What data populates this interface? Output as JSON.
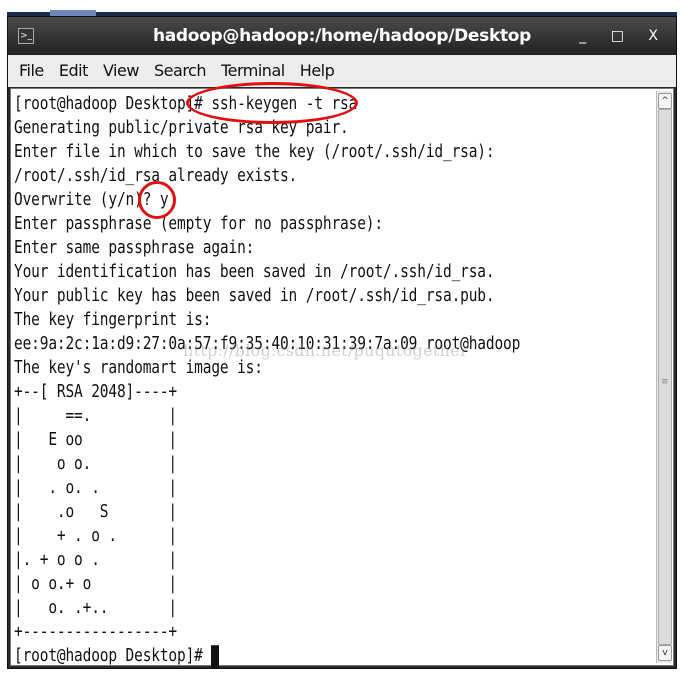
{
  "window": {
    "title": "hadoop@hadoop:/home/hadoop/Desktop",
    "minimize": "_",
    "maximize": "□",
    "close": "X",
    "icon": "terminal-icon"
  },
  "menu": [
    "File",
    "Edit",
    "View",
    "Search",
    "Terminal",
    "Help"
  ],
  "terminal": {
    "lines": [
      "[root@hadoop Desktop]# ssh-keygen -t rsa",
      "Generating public/private rsa key pair.",
      "Enter file in which to save the key (/root/.ssh/id_rsa):",
      "/root/.ssh/id_rsa already exists.",
      "Overwrite (y/n)? y",
      "Enter passphrase (empty for no passphrase):",
      "Enter same passphrase again:",
      "Your identification has been saved in /root/.ssh/id_rsa.",
      "Your public key has been saved in /root/.ssh/id_rsa.pub.",
      "The key fingerprint is:",
      "ee:9a:2c:1a:d9:27:0a:57:f9:35:40:10:31:39:7a:09 root@hadoop",
      "The key's randomart image is:",
      "+--[ RSA 2048]----+",
      "|     ==.         |",
      "|   E oo          |",
      "|    o o.         |",
      "|   . o. .        |",
      "|    .o   S       |",
      "|    + . o .      |",
      "|. + o o .        |",
      "| o o.+ o         |",
      "|   o. .+..       |",
      "+-----------------+"
    ],
    "prompt": "[root@hadoop Desktop]# "
  },
  "watermark": "http://blog.csdn.net/puqutogether",
  "annotation_color": "#e01010"
}
